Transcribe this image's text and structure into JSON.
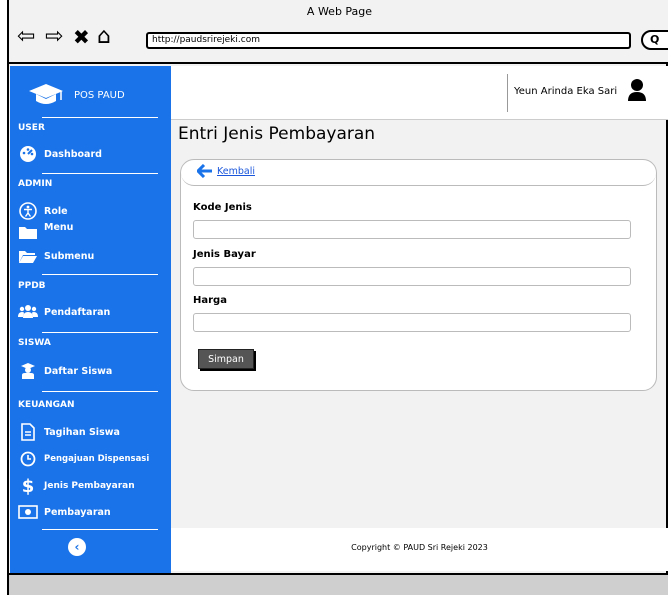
{
  "window": {
    "title": "A Web Page",
    "url": "http://paudsrirejeki.com"
  },
  "sidebar": {
    "brand": "POS PAUD",
    "sections": [
      {
        "title": "USER",
        "items": [
          {
            "label": "Dashboard",
            "icon": "dashboard-gauge-icon"
          }
        ]
      },
      {
        "title": "ADMIN",
        "items": [
          {
            "label": "Role",
            "icon": "accessibility-icon"
          },
          {
            "label": "Menu",
            "icon": "folder-icon"
          },
          {
            "label": "Submenu",
            "icon": "folder-open-icon"
          }
        ]
      },
      {
        "title": "PPDB",
        "items": [
          {
            "label": "Pendaftaran",
            "icon": "users-icon"
          }
        ]
      },
      {
        "title": "SISWA",
        "items": [
          {
            "label": "Daftar Siswa",
            "icon": "student-icon"
          }
        ]
      },
      {
        "title": "KEUANGAN",
        "items": [
          {
            "label": "Tagihan Siswa",
            "icon": "document-icon"
          },
          {
            "label": "Pengajuan Dispensasi",
            "icon": "clock-icon"
          },
          {
            "label": "Jenis Pembayaran",
            "icon": "dollar-icon"
          },
          {
            "label": "Pembayaran",
            "icon": "money-bill-icon"
          }
        ]
      }
    ],
    "toggle": "‹"
  },
  "topbar": {
    "user_name": "Yeun Arinda Eka Sari"
  },
  "main": {
    "title": "Entri Jenis Pembayaran",
    "back_label": "Kembali",
    "fields": [
      {
        "label": "Kode Jenis",
        "value": "",
        "placeholder": ""
      },
      {
        "label": "Jenis Bayar",
        "value": "",
        "placeholder": ""
      },
      {
        "label": "Harga",
        "value": "",
        "placeholder": ""
      }
    ],
    "submit_label": "Simpan"
  },
  "footer": {
    "copyright": "Copyright © PAUD Sri Rejeki 2023"
  },
  "colors": {
    "sidebar": "#1a73e8",
    "link": "#1a56db",
    "button": "#555555"
  }
}
